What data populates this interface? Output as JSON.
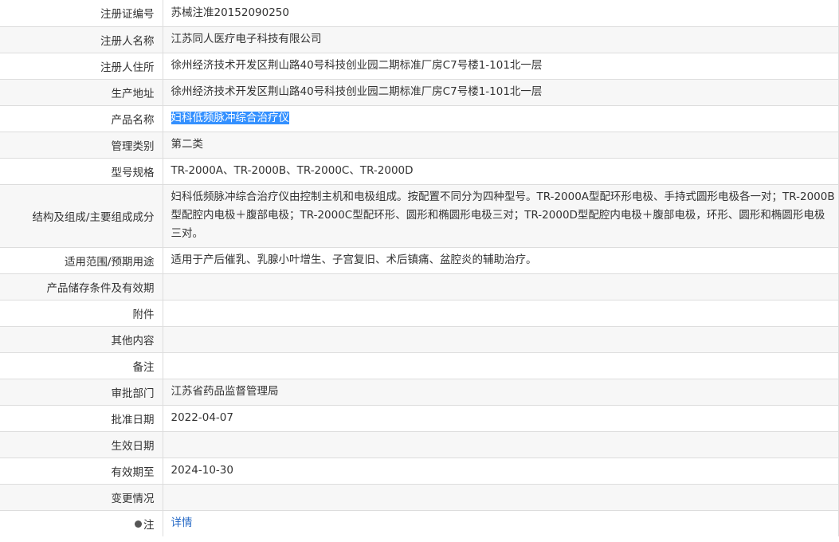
{
  "rows": [
    {
      "label": "注册证编号",
      "value": "苏械注准20152090250"
    },
    {
      "label": "注册人名称",
      "value": "江苏同人医疗电子科技有限公司"
    },
    {
      "label": "注册人住所",
      "value": "徐州经济技术开发区荆山路40号科技创业园二期标准厂房C7号楼1-101北一层"
    },
    {
      "label": "生产地址",
      "value": "徐州经济技术开发区荆山路40号科技创业园二期标准厂房C7号楼1-101北一层"
    },
    {
      "label": "产品名称",
      "value": "妇科低频脉冲综合治疗仪"
    },
    {
      "label": "管理类别",
      "value": "第二类"
    },
    {
      "label": "型号规格",
      "value": "TR-2000A、TR-2000B、TR-2000C、TR-2000D"
    },
    {
      "label": "结构及组成/主要组成成分",
      "value": "妇科低频脉冲综合治疗仪由控制主机和电极组成。按配置不同分为四种型号。TR-2000A型配环形电极、手持式圆形电极各一对；TR-2000B型配腔内电极＋腹部电极；TR-2000C型配环形、圆形和椭圆形电极三对；TR-2000D型配腔内电极＋腹部电极，环形、圆形和椭圆形电极三对。"
    },
    {
      "label": "适用范围/预期用途",
      "value": "适用于产后催乳、乳腺小叶增生、子宫复旧、术后镇痛、盆腔炎的辅助治疗。"
    },
    {
      "label": "产品储存条件及有效期",
      "value": ""
    },
    {
      "label": "附件",
      "value": ""
    },
    {
      "label": "其他内容",
      "value": ""
    },
    {
      "label": "备注",
      "value": ""
    },
    {
      "label": "审批部门",
      "value": "江苏省药品监督管理局"
    },
    {
      "label": "批准日期",
      "value": "2022-04-07"
    },
    {
      "label": "生效日期",
      "value": ""
    },
    {
      "label": "有效期至",
      "value": "2024-10-30"
    },
    {
      "label": "变更情况",
      "value": ""
    },
    {
      "label": "注",
      "value": "详情"
    }
  ],
  "icons": {
    "note": "info-dot-icon"
  }
}
